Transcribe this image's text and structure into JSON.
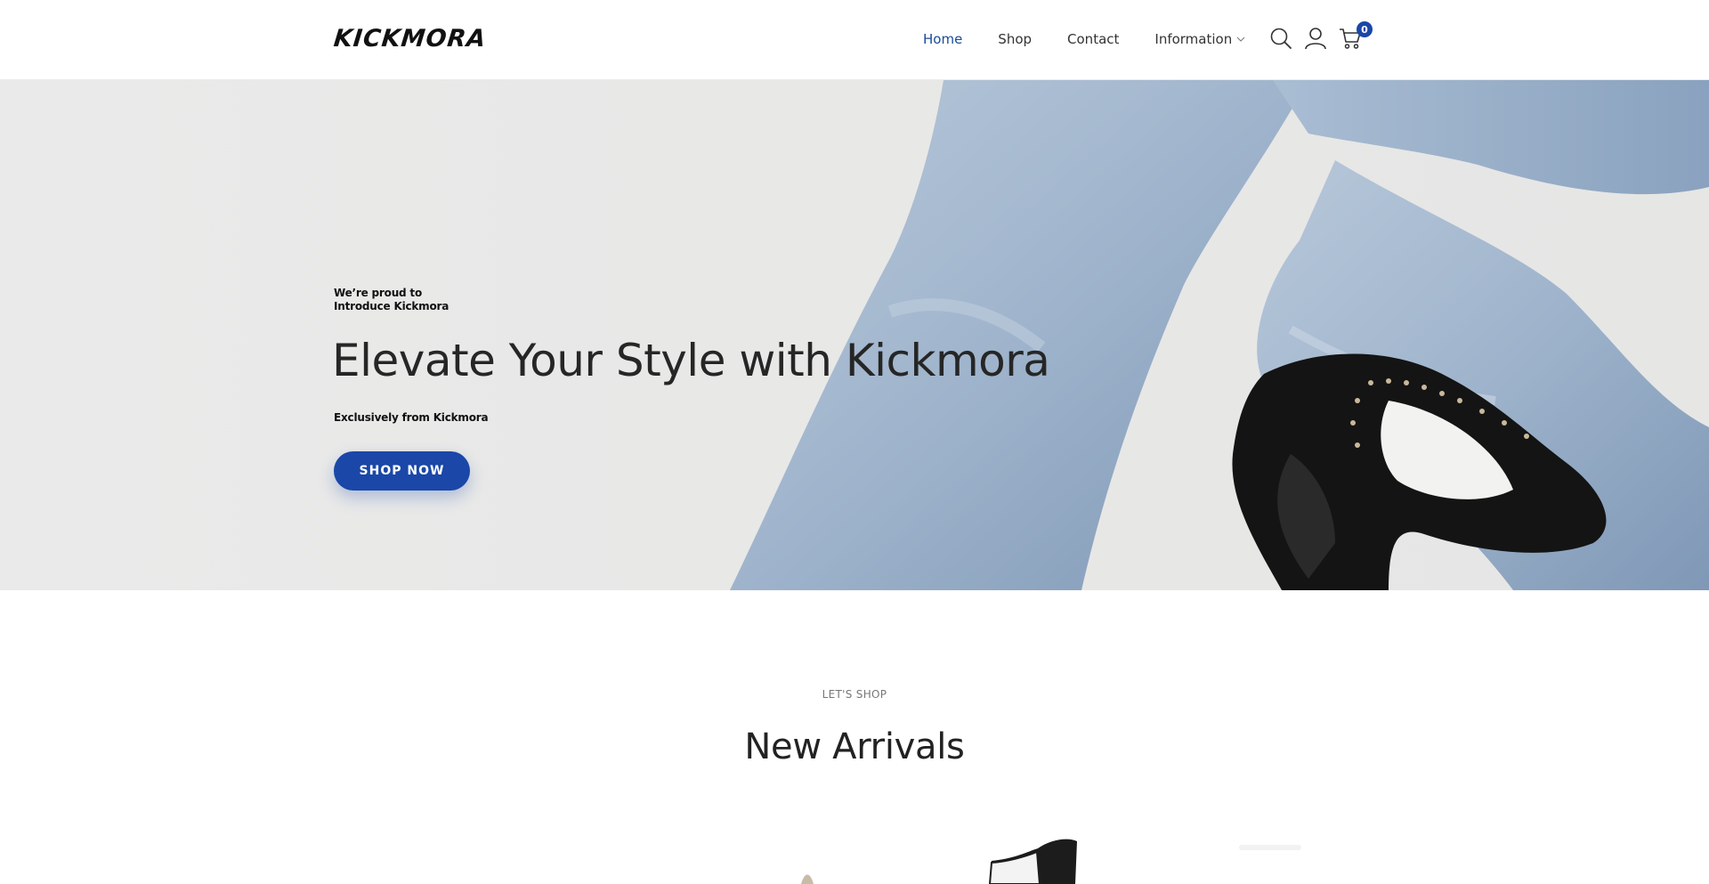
{
  "brand": {
    "logo_text": "KICKMORA"
  },
  "nav": {
    "items": [
      {
        "label": "Home",
        "active": true
      },
      {
        "label": "Shop"
      },
      {
        "label": "Contact"
      },
      {
        "label": "Information",
        "has_dropdown": true
      }
    ]
  },
  "header_icons": {
    "search": "search-icon",
    "account": "user-icon",
    "cart": "cart-icon",
    "cart_count": "0"
  },
  "hero": {
    "pretitle_line1": "We’re proud to",
    "pretitle_line2": "Introduce Kickmora",
    "title": "Elevate Your Style with Kickmora",
    "subtitle": "Exclusively from Kickmora",
    "cta_label": "SHOP NOW"
  },
  "new_arrivals": {
    "eyebrow": "LET'S SHOP",
    "title": "New Arrivals"
  },
  "colors": {
    "accent": "#1a47a8",
    "nav_active": "#1a4a99",
    "hero_bg": "#e8e8e7",
    "denim": "#9fb6cf"
  }
}
